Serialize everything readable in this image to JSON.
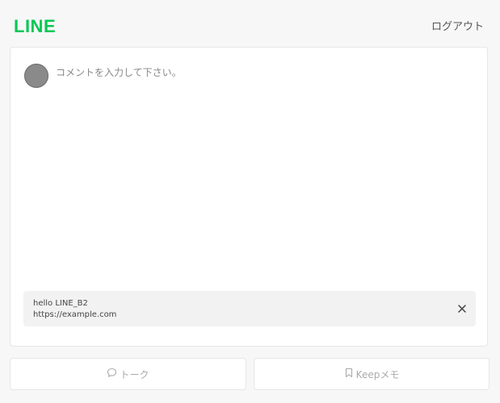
{
  "header": {
    "logo": "LINE",
    "logout_label": "ログアウト"
  },
  "composer": {
    "placeholder": "コメントを入力して下さい。",
    "value": ""
  },
  "link_preview": {
    "title": "hello LINE_B2",
    "url": "https://example.com"
  },
  "actions": {
    "talk_label": "トーク",
    "keep_label": "Keepメモ"
  },
  "colors": {
    "brand": "#06c755",
    "disabled_text": "#aaaaaa"
  },
  "icons": {
    "avatar": "avatar",
    "close": "close-icon",
    "talk": "speech-bubble-icon",
    "keep": "bookmark-icon"
  }
}
